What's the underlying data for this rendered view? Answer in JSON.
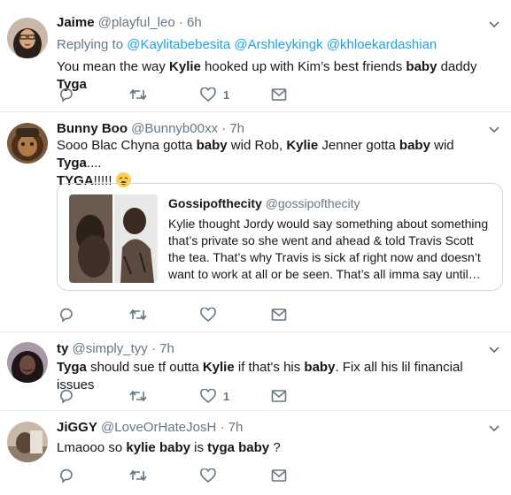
{
  "tweets": [
    {
      "name": "Jaime",
      "handle": "@playful_leo",
      "sep": "·",
      "time": "6h",
      "replying_label": "Replying to",
      "replying_to": [
        "@Kaylitabebesita",
        "@Arshleykingk",
        "@khloekardashian"
      ],
      "text_parts": [
        {
          "t": "You mean the way ",
          "b": false
        },
        {
          "t": "Kylie",
          "b": true
        },
        {
          "t": " hooked up with Kim’s best friends ",
          "b": false
        },
        {
          "t": "baby",
          "b": true
        },
        {
          "t": " daddy ",
          "b": false
        },
        {
          "t": "Tyga",
          "b": true
        }
      ],
      "actions": {
        "reply": "",
        "retweet": "",
        "like": "1",
        "message": ""
      }
    },
    {
      "name": "Bunny Boo",
      "handle": "@Bunnyb00xx",
      "sep": "·",
      "time": "7h",
      "text_line1": [
        {
          "t": "Sooo Blac Chyna gotta ",
          "b": false
        },
        {
          "t": "baby",
          "b": true
        },
        {
          "t": " wid Rob, ",
          "b": false
        },
        {
          "t": "Kylie",
          "b": true
        },
        {
          "t": " Jenner gotta ",
          "b": false
        },
        {
          "t": "baby",
          "b": true
        },
        {
          "t": " wid ",
          "b": false
        },
        {
          "t": "Tyga",
          "b": true
        },
        {
          "t": "....",
          "b": false
        }
      ],
      "text_line2": [
        {
          "t": "TYGA",
          "b": true
        },
        {
          "t": "!!!!! ",
          "b": false
        }
      ],
      "emoji": "weary-face-emoji",
      "quote": {
        "name": "Gossipofthecity",
        "handle": "@gossipofthecity",
        "text": "Kylie thought Jordy would say something about something that’s private so she went and ahead & told Travis Scott the tea. That’s why Travis is sick af right now and doesn’t want to work at all or be seen. That’s all imma say until…"
      },
      "actions": {
        "reply": "",
        "retweet": "",
        "like": "",
        "message": ""
      }
    },
    {
      "name": "ty",
      "handle": "@simply_tyy",
      "sep": "·",
      "time": "7h",
      "text_parts": [
        {
          "t": "Tyga",
          "b": true
        },
        {
          "t": " should sue tf outta ",
          "b": false
        },
        {
          "t": "Kylie",
          "b": true
        },
        {
          "t": " if that's his ",
          "b": false
        },
        {
          "t": "baby",
          "b": true
        },
        {
          "t": ". Fix all his lil financial issues",
          "b": false
        }
      ],
      "actions": {
        "reply": "",
        "retweet": "",
        "like": "1",
        "message": ""
      }
    },
    {
      "name": "JiGGY",
      "handle": "@LoveOrHateJosH",
      "sep": "·",
      "time": "7h",
      "text_parts": [
        {
          "t": "Lmaooo so ",
          "b": false
        },
        {
          "t": "kylie",
          "b": true
        },
        {
          "t": " ",
          "b": false
        },
        {
          "t": "baby",
          "b": true
        },
        {
          "t": " is ",
          "b": false
        },
        {
          "t": "tyga",
          "b": true
        },
        {
          "t": " ",
          "b": false
        },
        {
          "t": "baby",
          "b": true
        },
        {
          "t": "  ?",
          "b": false
        }
      ],
      "actions": {
        "reply": "",
        "retweet": "",
        "like": "",
        "message": ""
      }
    }
  ],
  "icons": {
    "reply": "reply-icon",
    "retweet": "retweet-icon",
    "like": "heart-icon",
    "message": "direct-message-icon",
    "menu": "chevron-down-icon"
  },
  "colors": {
    "name": "#14171a",
    "meta": "#657786",
    "link": "#1da1f2",
    "border": "#e6ecf0"
  }
}
